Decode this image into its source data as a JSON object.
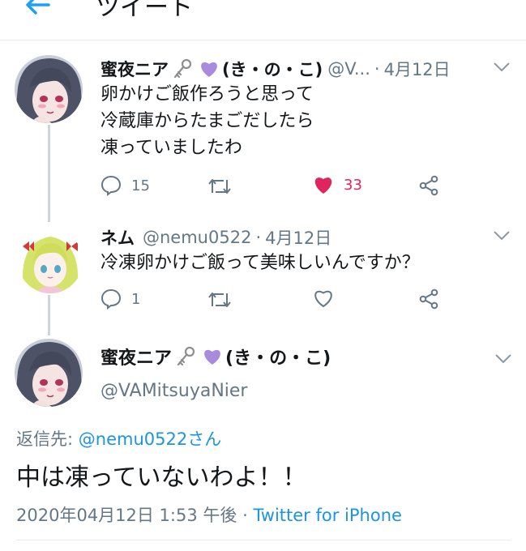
{
  "header": {
    "title": "ツイート"
  },
  "tweets": [
    {
      "name": "蜜夜ニア",
      "name_suffix": "(き・の・こ)",
      "handle": "@V...",
      "date": "4月12日",
      "lines": [
        "卵かけご飯作ろうと思って",
        "冷蔵庫からたまごだしたら",
        "凍っていましたわ"
      ],
      "replies": "15",
      "likes": "33"
    },
    {
      "name": "ネム",
      "handle": "@nemu0522",
      "date": "4月12日",
      "lines": [
        "冷凍卵かけご飯って美味しいんですか？"
      ],
      "replies": "1"
    }
  ],
  "main_tweet": {
    "name": "蜜夜ニア",
    "name_suffix": "(き・の・こ)",
    "handle": "@VAMitsuyaNier",
    "reply_prefix": "返信先: ",
    "reply_to": "@nemu0522さん",
    "text": "中は凍っていないわよ！！",
    "timestamp": "2020年04月12日 1:53 午後",
    "separator": " · ",
    "source": "Twitter for iPhone"
  },
  "colors": {
    "link": "#1b95e0",
    "like": "#e0245e",
    "secondary": "#657786",
    "divider": "#e6ecf0"
  },
  "icons": [
    "back-arrow-icon",
    "key-emoji-icon",
    "purple-heart-emoji-icon",
    "chevron-down-icon",
    "reply-icon",
    "retweet-icon",
    "like-icon",
    "share-icon"
  ]
}
